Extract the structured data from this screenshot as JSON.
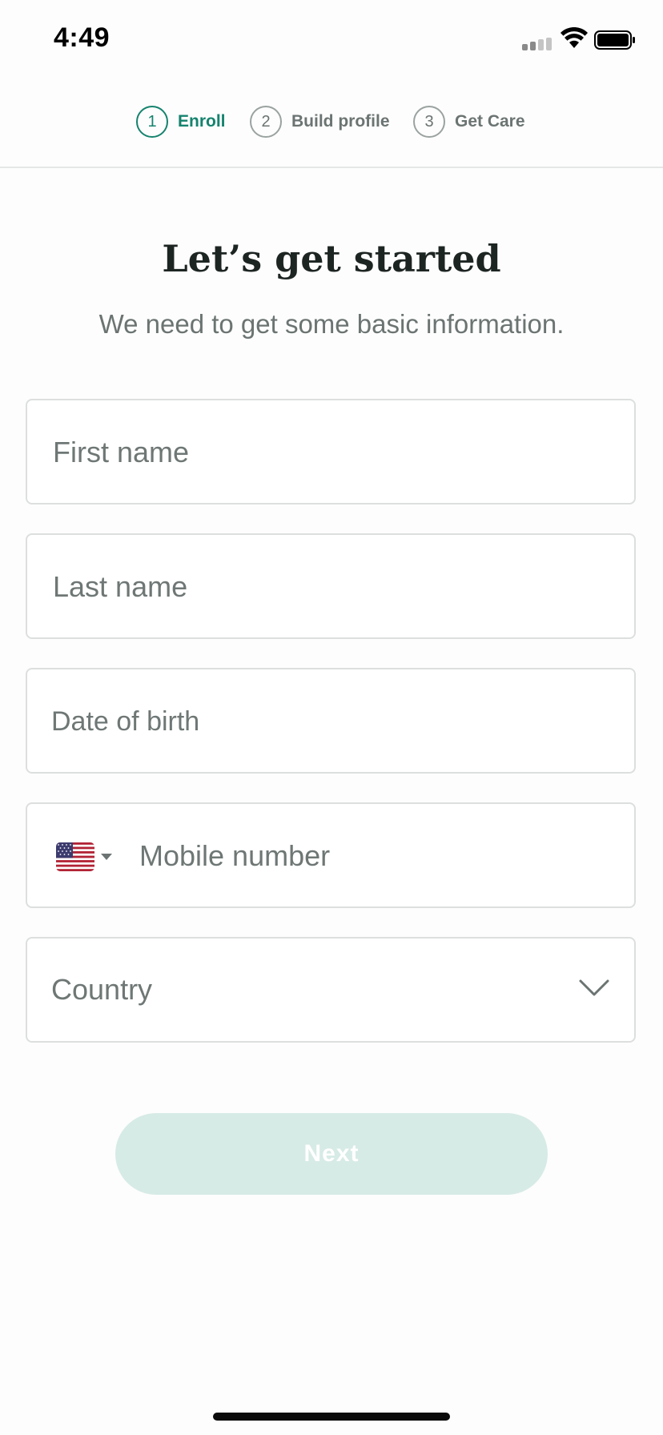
{
  "status_bar": {
    "time": "4:49"
  },
  "stepper": {
    "steps": [
      {
        "number": "1",
        "label": "Enroll",
        "active": true
      },
      {
        "number": "2",
        "label": "Build profile",
        "active": false
      },
      {
        "number": "3",
        "label": "Get Care",
        "active": false
      }
    ]
  },
  "header": {
    "title": "Let’s get started",
    "subtitle": "We need to get some basic information."
  },
  "form": {
    "first_name": {
      "value": "",
      "placeholder": "First name"
    },
    "last_name": {
      "value": "",
      "placeholder": "Last name"
    },
    "date_of_birth": {
      "value": "",
      "placeholder": "Date of birth"
    },
    "mobile": {
      "value": "",
      "placeholder": "Mobile number",
      "country_flag": "us-flag-icon"
    },
    "country": {
      "value": "",
      "placeholder": "Country"
    }
  },
  "next_button": {
    "label": "Next"
  },
  "colors": {
    "accent": "#15836e",
    "button_disabled": "#d7ebe6",
    "text_muted": "#6b7472",
    "heading": "#1d2523"
  }
}
